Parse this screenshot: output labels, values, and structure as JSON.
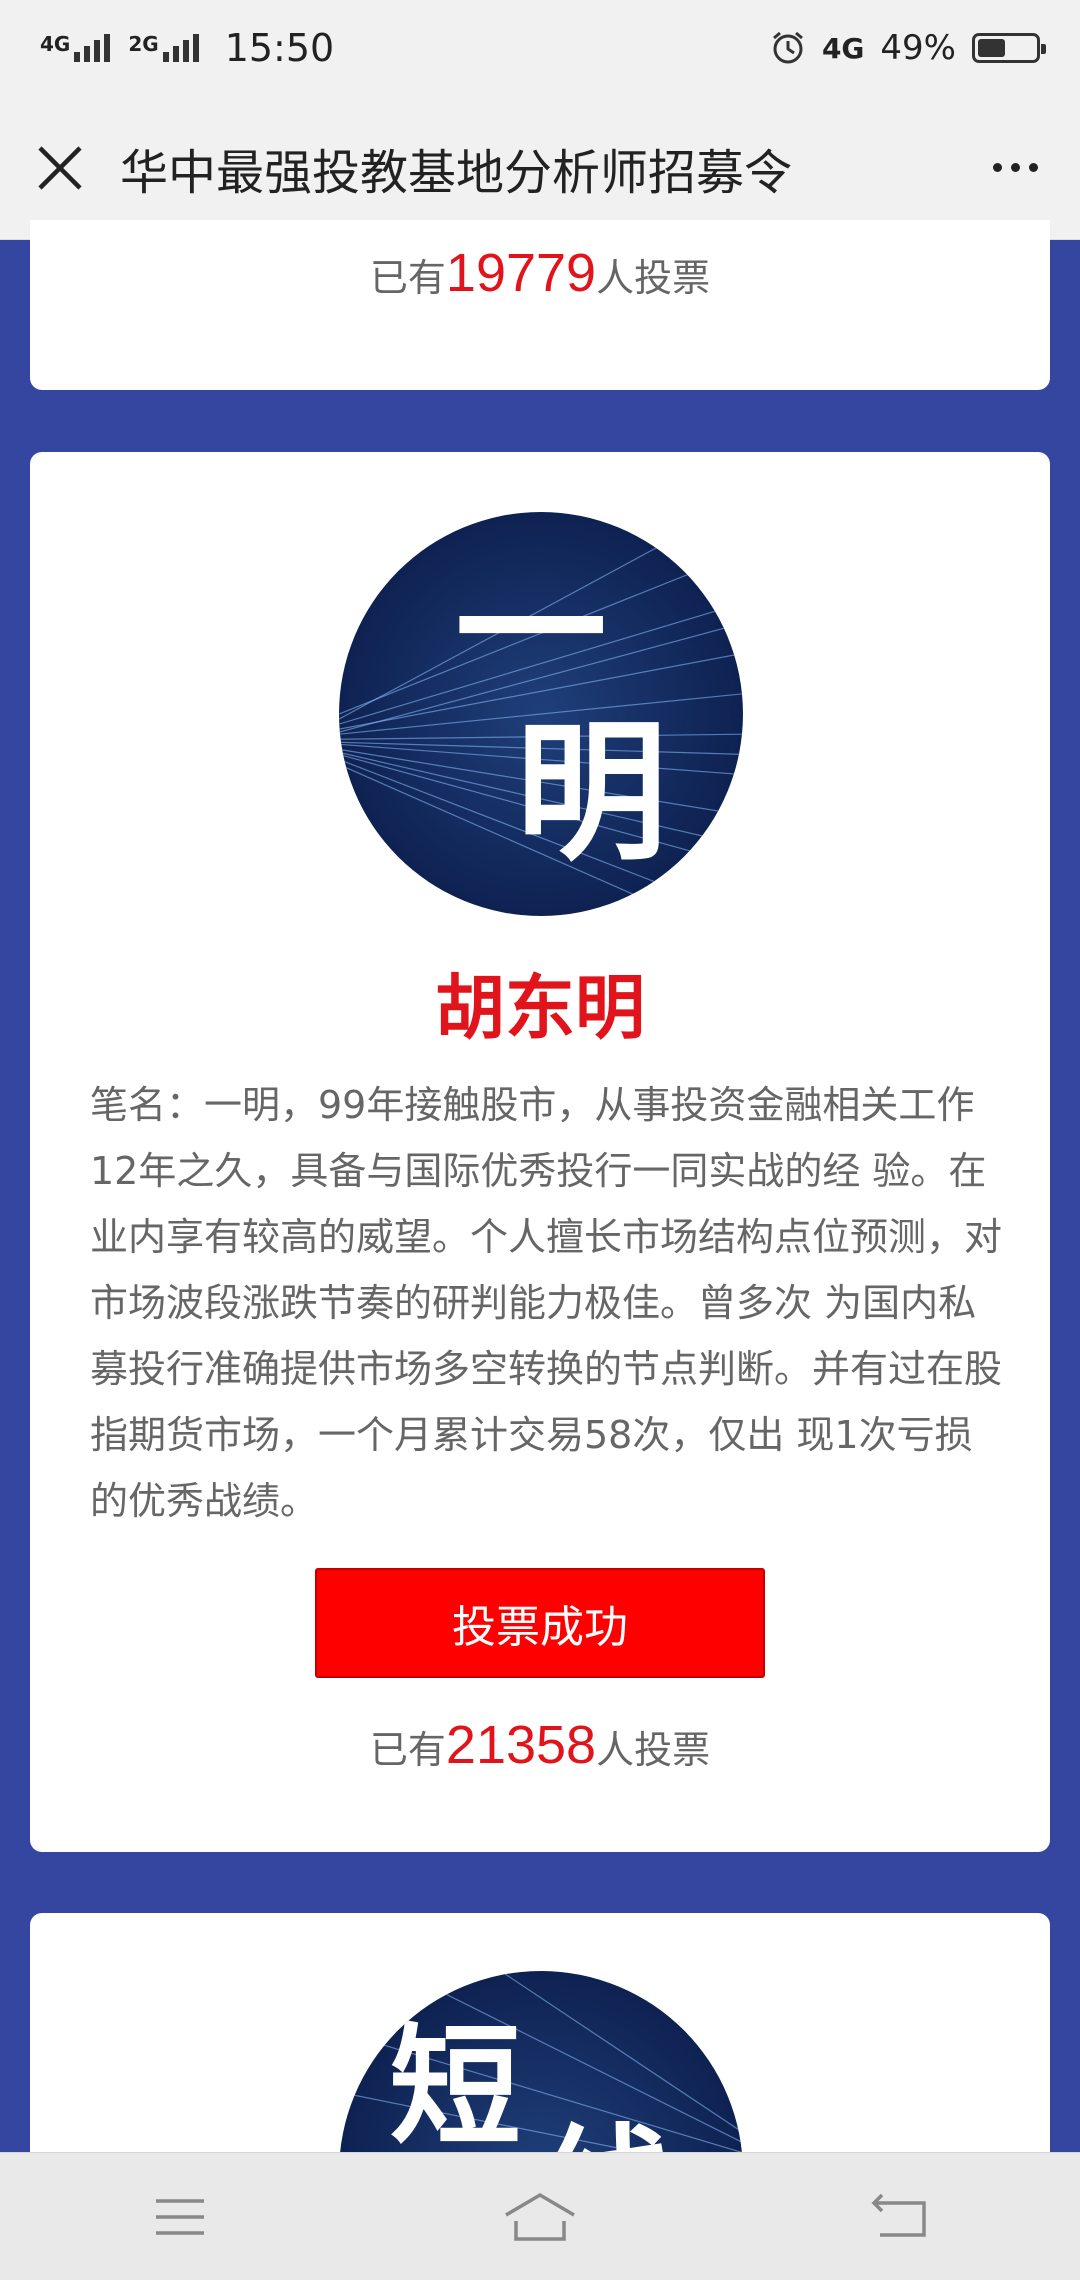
{
  "status_bar": {
    "signal_1": "4G",
    "signal_2": "2G",
    "time": "15:50",
    "network": "4G",
    "battery": "49%",
    "battery_level": 0.49
  },
  "title_bar": {
    "title": "华中最强投教基地分析师招募令",
    "close_icon": "close-icon",
    "more_icon": "more-icon"
  },
  "cards": {
    "top": {
      "vote_prefix": "已有",
      "vote_count": "19779",
      "vote_suffix": "人投票"
    },
    "main": {
      "avatar_text": "一明",
      "name": "胡东明",
      "bio": "笔名：一明，99年接触股市，从事投资金融相关工作12年之久，具备与国际优秀投行一同实战的经 验。在业内享有较高的威望。个人擅长市场结构点位预测，对市场波段涨跌节奏的研判能力极佳。曾多次 为国内私募投行准确提供市场多空转换的节点判断。并有过在股指期货市场，一个月累计交易58次，仅出 现1次亏损的优秀战绩。",
      "button_label": "投票成功",
      "vote_prefix": "已有",
      "vote_count": "21358",
      "vote_suffix": "人投票"
    },
    "bottom": {
      "avatar_text": "短线"
    }
  },
  "colors": {
    "background": "#3446a0",
    "accent_red": "#e1141b",
    "button_red": "#ff0000"
  },
  "nav_bar": {
    "icons": [
      "menu-icon",
      "home-icon",
      "back-icon"
    ]
  }
}
